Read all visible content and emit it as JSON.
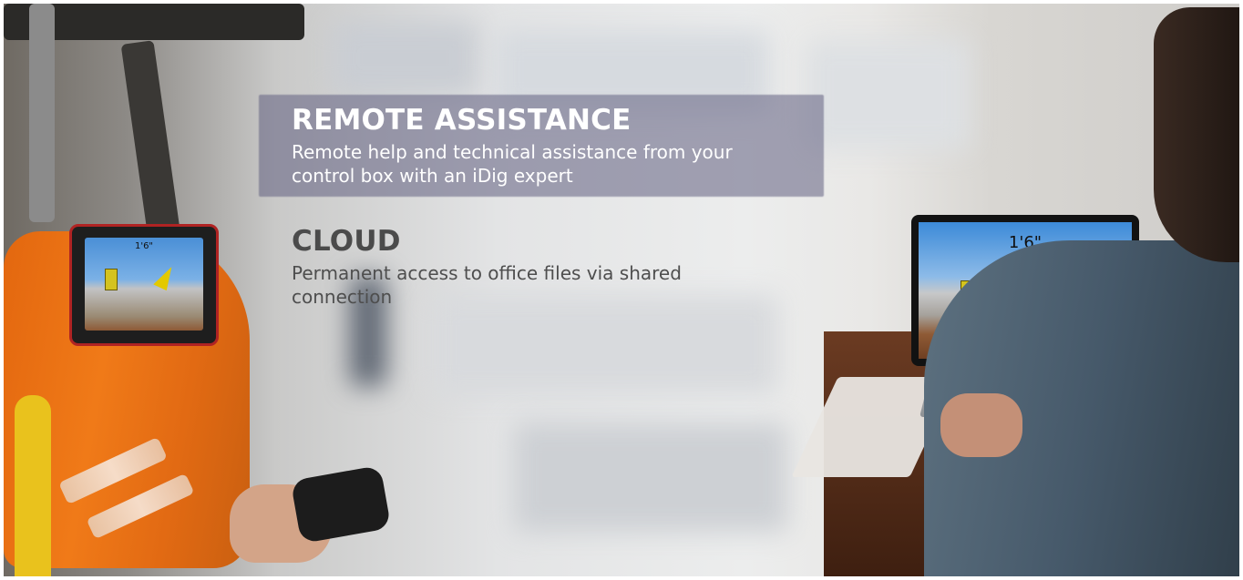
{
  "sections": [
    {
      "title": "REMOTE ASSISTANCE",
      "body": "Remote help and technical assistance from your control box with an iDig expert"
    },
    {
      "title": "CLOUD",
      "body": "Permanent access to office files via shared connection"
    }
  ],
  "cab_tablet": {
    "readout": "1'6\""
  },
  "laptop_display": {
    "readout": "1'6\""
  },
  "colors": {
    "panel": "#605e80",
    "safety_orange": "#f07a18",
    "tablet_border": "#b02323",
    "bucket_yellow": "#d5c41d"
  }
}
